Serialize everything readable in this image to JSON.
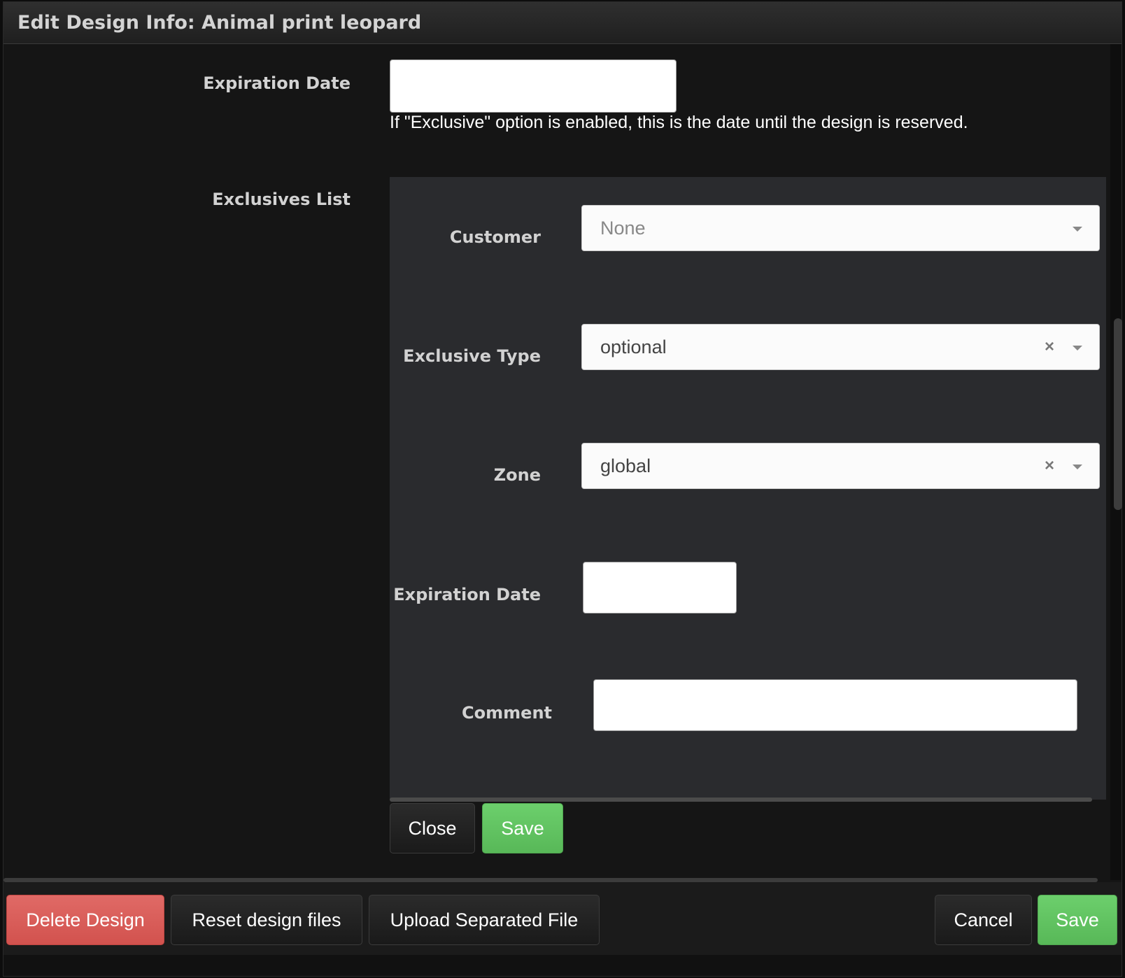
{
  "dialog": {
    "title": "Edit Design Info: Animal print leopard"
  },
  "form": {
    "expiration_label": "Expiration Date",
    "expiration_value": "",
    "expiration_help": "If \"Exclusive\" option is enabled, this is the date until the design is reserved.",
    "exclusives_label": "Exclusives List"
  },
  "exclusive_panel": {
    "customer_label": "Customer",
    "customer_value": "None",
    "exclusive_type_label": "Exclusive Type",
    "exclusive_type_value": "optional",
    "zone_label": "Zone",
    "zone_value": "global",
    "expiration_label": "Expiration Date",
    "expiration_value": "",
    "comment_label": "Comment",
    "comment_value": "",
    "clear_glyph": "×",
    "close_label": "Close",
    "save_label": "Save"
  },
  "footer": {
    "delete_label": "Delete Design",
    "reset_label": "Reset design files",
    "upload_label": "Upload Separated File",
    "cancel_label": "Cancel",
    "save_label": "Save"
  },
  "colors": {
    "danger": "#d9534f",
    "success": "#5cb85c",
    "background": "#151515",
    "panel": "#2a2b2e"
  }
}
